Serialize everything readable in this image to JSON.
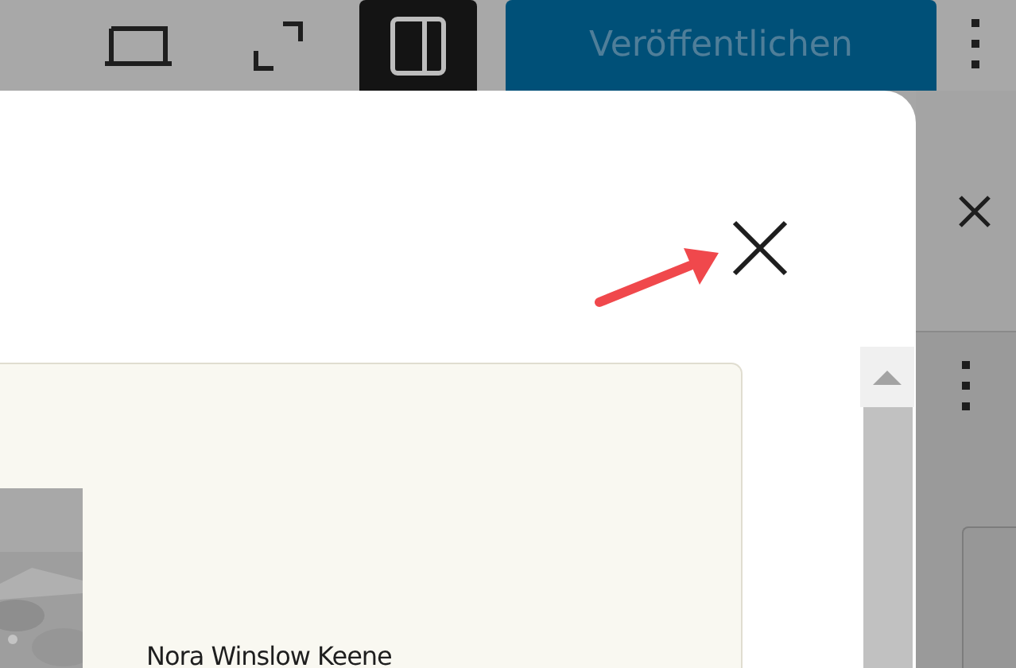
{
  "toolbar": {
    "tools": [
      {
        "kind": "laptop",
        "pressed": false
      },
      {
        "kind": "fullscreen",
        "pressed": false
      },
      {
        "kind": "sidebar",
        "pressed": true
      }
    ],
    "publish": {
      "label": "Veröffentlichen"
    }
  },
  "modal": {
    "card": {
      "author": "Nora Winslow Keene"
    }
  },
  "annotation": {
    "kind": "arrow"
  }
}
